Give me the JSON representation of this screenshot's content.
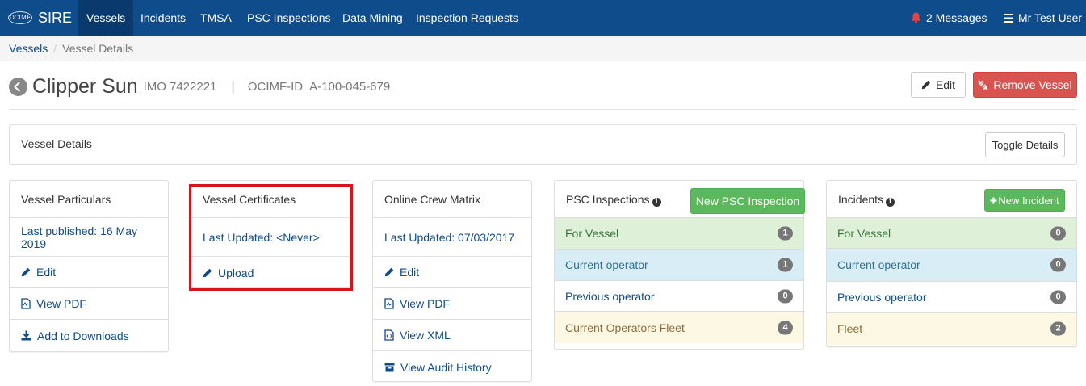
{
  "nav": {
    "logo_text": "OCIMF",
    "brand": "SIRE",
    "items": [
      "Vessels",
      "Incidents",
      "TMSA",
      "PSC Inspections",
      "Data Mining",
      "Inspection Requests"
    ],
    "messages": "2 Messages",
    "user": "Mr Test User"
  },
  "breadcrumb": {
    "link": "Vessels",
    "separator": "/",
    "current": "Vessel Details"
  },
  "vessel": {
    "name": "Clipper Sun",
    "imo_label": "IMO",
    "imo": "7422221",
    "separator": "|",
    "ocimf_label": "OCIMF-ID",
    "ocimf_id": "A-100-045-679"
  },
  "actions": {
    "edit": "Edit",
    "remove": "Remove Vessel"
  },
  "details": {
    "title": "Vessel Details",
    "toggle": "Toggle Details"
  },
  "particulars": {
    "title": "Vessel Particulars",
    "published": "Last published: 16 May 2019",
    "items": [
      "Edit",
      "View PDF",
      "Add to Downloads"
    ]
  },
  "certificates": {
    "title": "Vessel Certificates",
    "updated": "Last Updated: <Never>",
    "items": [
      "Upload"
    ]
  },
  "crew": {
    "title": "Online Crew Matrix",
    "updated": "Last Updated: 07/03/2017",
    "items": [
      "Edit",
      "View PDF",
      "View XML",
      "View Audit History"
    ]
  },
  "psc": {
    "title": "PSC Inspections",
    "new_button": "New PSC Inspection",
    "rows": [
      {
        "label": "For Vessel",
        "count": "1"
      },
      {
        "label": "Current operator",
        "count": "1"
      },
      {
        "label": "Previous operator",
        "count": "0"
      },
      {
        "label": "Current Operators Fleet",
        "count": "4"
      }
    ]
  },
  "incidents": {
    "title": "Incidents",
    "new_button": "New Incident",
    "rows": [
      {
        "label": "For Vessel",
        "count": "0"
      },
      {
        "label": "Current operator",
        "count": "0"
      },
      {
        "label": "Previous operator",
        "count": "0"
      },
      {
        "label": "Fleet",
        "count": "2"
      }
    ]
  },
  "colors": {
    "navbar": "#0f4c8c",
    "link": "#0f4c8c",
    "danger": "#d9534f",
    "success": "#5cb85c",
    "highlight": "#d9131c"
  }
}
